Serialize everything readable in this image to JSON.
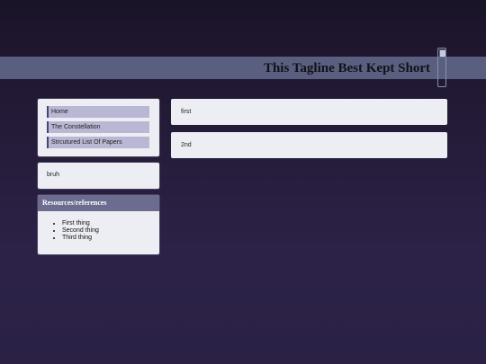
{
  "header": {
    "tagline": "This Tagline Best Kept Short",
    "image_icon": "broken-image-icon"
  },
  "sidebar": {
    "nav_items": [
      {
        "label": "Home"
      },
      {
        "label": "The Constellation"
      },
      {
        "label": "Strcutured List Of Papers"
      }
    ],
    "text_box": "bruh",
    "resources": {
      "title": "Resources/references",
      "items": [
        "First thing",
        "Second thing",
        "Third thing"
      ]
    }
  },
  "main": {
    "posts": [
      {
        "text": "first"
      },
      {
        "text": "2nd"
      }
    ]
  },
  "colors": {
    "header_band": "#5a5f80",
    "nav_item_bg": "#b9b7d4",
    "panel_bg": "#eceef3",
    "resources_header_bg": "#6b6c90"
  }
}
